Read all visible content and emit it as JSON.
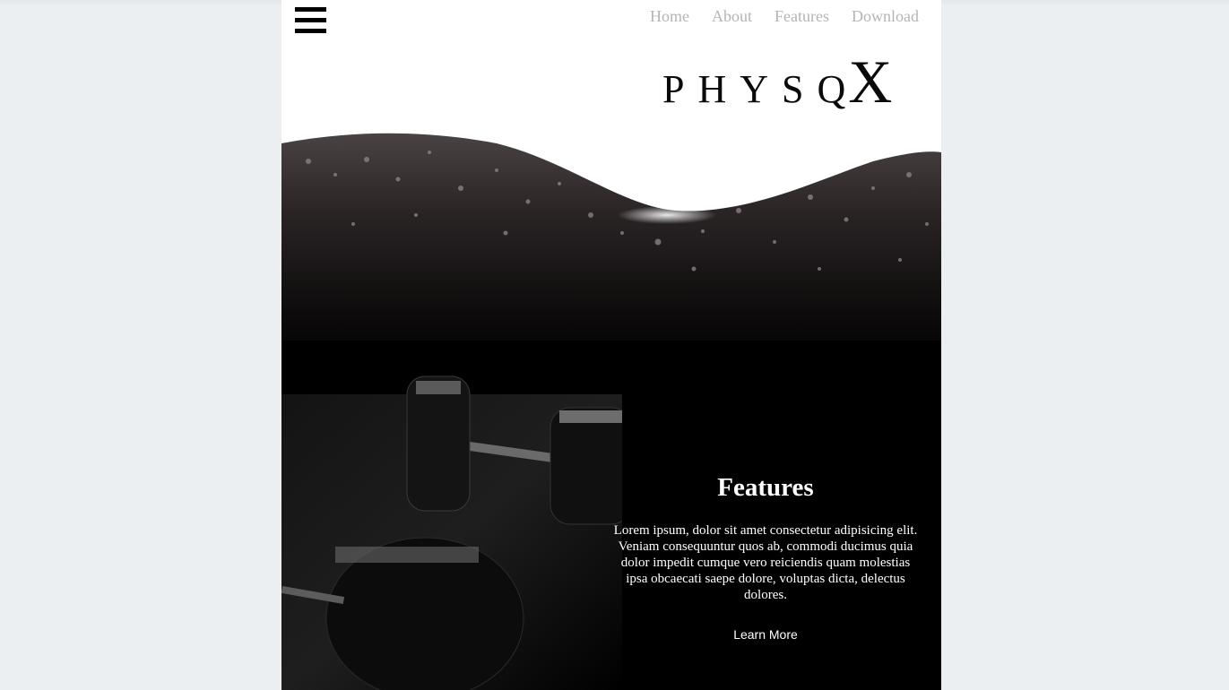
{
  "nav": {
    "menu_icon": "hamburger-icon",
    "links": [
      "Home",
      "About",
      "Features",
      "Download"
    ]
  },
  "brand": {
    "wordmark": "PHYSQ",
    "wordmark_x": "X"
  },
  "features": {
    "title": "Features",
    "body": "Lorem ipsum, dolor sit amet consectetur adipisicing elit. Veniam consequuntur quos ab, commodi ducimus quia dolor impedit cumque vero reiciendis quam molestias ipsa obcaecati saepe dolore, voluptas dicta, delectus dolores.",
    "button_label": "Learn More"
  },
  "colors": {
    "page_background": "#ebeff2",
    "nav_link": "#b5b5b5",
    "hero_dark": "#000000",
    "text_light": "#ffffff"
  }
}
